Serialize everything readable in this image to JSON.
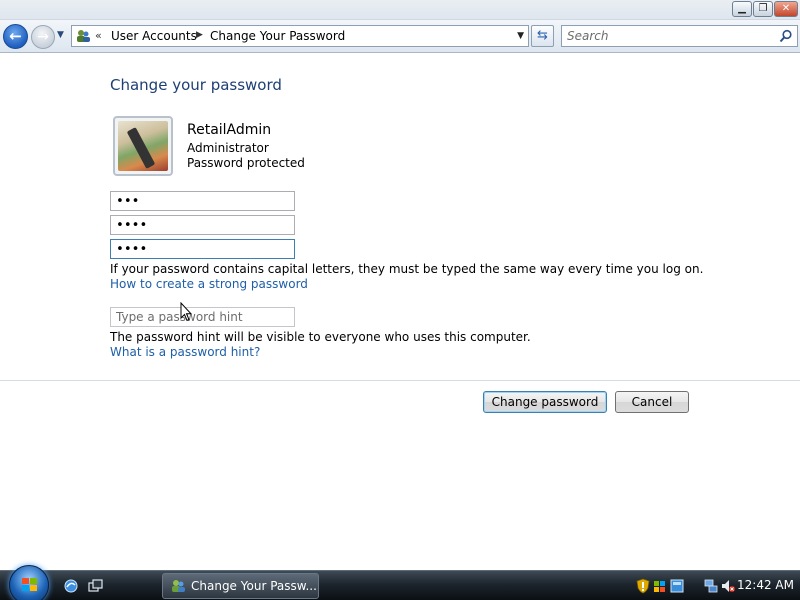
{
  "window": {
    "minimize_glyph": "▁",
    "maximize_glyph": "❐",
    "close_glyph": "✕"
  },
  "nav": {
    "back_glyph": "←",
    "forward_glyph": "→",
    "recent_glyph": "▼",
    "chevron": "«",
    "crumbs": [
      "User Accounts",
      "Change Your Password"
    ],
    "crumb_arrow": "▶",
    "dropdown_glyph": "▼",
    "refresh_glyph": "⇆",
    "search_placeholder": "Search"
  },
  "content": {
    "heading": "Change your password",
    "user": {
      "name": "RetailAdmin",
      "role": "Administrator",
      "status": "Password protected"
    },
    "fields": {
      "current_password": "•••",
      "new_password": "••••",
      "confirm_password": "••••",
      "hint_placeholder": "Type a password hint"
    },
    "caps_note": "If your password contains capital letters, they must be typed the same way every time you log on.",
    "strong_link": "How to create a strong password",
    "hint_note": "The password hint will be visible to everyone who uses this computer.",
    "hint_link": "What is a password hint?",
    "buttons": {
      "change": "Change password",
      "cancel": "Cancel"
    }
  },
  "taskbar": {
    "task_label": "Change Your Passw...",
    "clock": "12:42 AM"
  },
  "colors": {
    "heading": "#1e3f74",
    "link": "#1e5fa8",
    "accent": "#3c7fb1"
  },
  "icons": [
    "back-arrow-icon",
    "forward-arrow-icon",
    "user-accounts-icon",
    "refresh-icon",
    "search-icon",
    "user-picture",
    "mouse-cursor-icon",
    "windows-flag-icon",
    "show-desktop-icon",
    "switch-windows-icon",
    "security-shield-icon",
    "network-icon",
    "volume-muted-icon"
  ]
}
